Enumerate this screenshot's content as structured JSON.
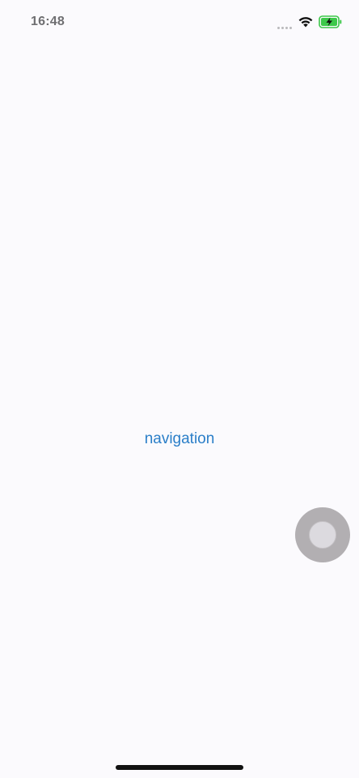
{
  "status_bar": {
    "time": "16:48",
    "icons": [
      "cellular-signal-icon",
      "wifi-icon",
      "battery-charging-icon"
    ],
    "battery_color": "#3dc84a"
  },
  "main": {
    "nav_link_label": "navigation",
    "nav_link_color": "#2a7ec8"
  },
  "overlay": {
    "assistive_touch_icon": "assistive-touch-icon"
  },
  "theme": {
    "background": "#fbfafd"
  }
}
